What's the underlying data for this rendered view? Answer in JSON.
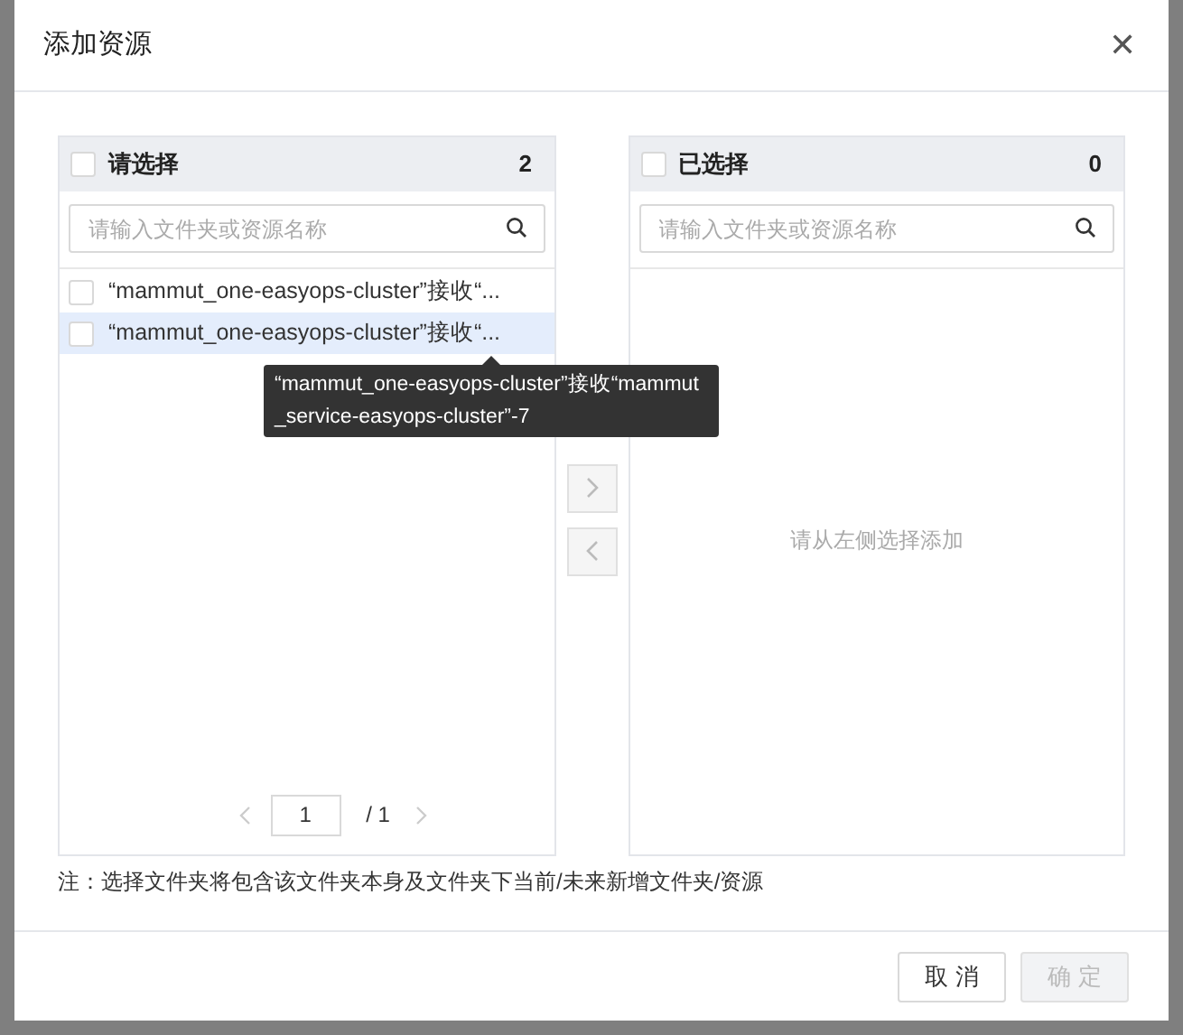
{
  "dialog": {
    "title": "添加资源",
    "close": "✕"
  },
  "source": {
    "title": "请选择",
    "checked": false,
    "count": "2",
    "search": {
      "placeholder": "请输入文件夹或资源名称"
    },
    "items": [
      {
        "label": "“mammut_one-easyops-cluster”接收“...",
        "checked": false,
        "highlighted": false
      },
      {
        "label": "“mammut_one-easyops-cluster”接收“...",
        "checked": false,
        "highlighted": true
      }
    ],
    "pagination": {
      "page": "1",
      "total": "/ 1"
    }
  },
  "tooltip": {
    "text": "“mammut_one-easyops-cluster”接收“mammut_service-easyops-cluster”-7"
  },
  "target": {
    "title": "已选择",
    "checked": false,
    "count": "0",
    "search": {
      "placeholder": "请输入文件夹或资源名称"
    },
    "empty": "请从左侧选择添加"
  },
  "note": "注：选择文件夹将包含该文件夹本身及文件夹下当前/未来新增文件夹/资源",
  "buttons": [
    {
      "label": "取 消",
      "disabled": false
    },
    {
      "label": "确 定",
      "disabled": true
    }
  ]
}
